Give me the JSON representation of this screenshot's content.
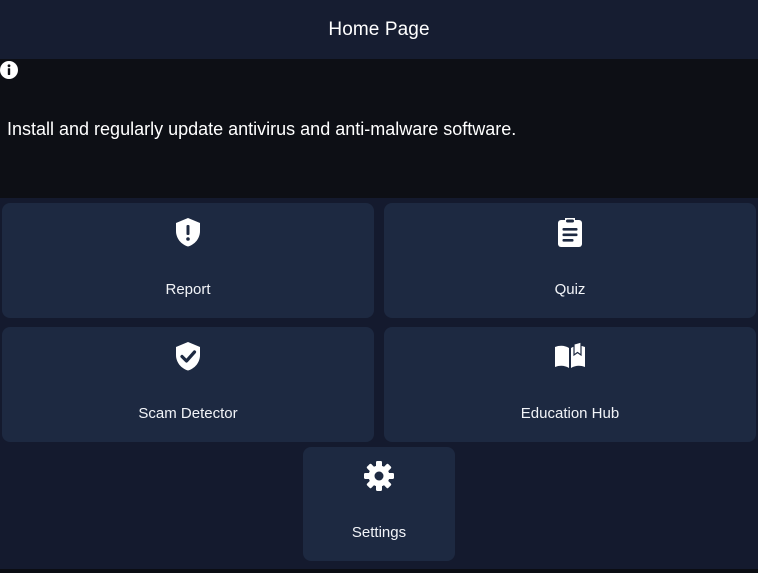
{
  "header": {
    "title": "Home Page"
  },
  "tip": {
    "icon": "info-icon",
    "text": "Install and regularly update antivirus and anti-malware software."
  },
  "tiles": [
    {
      "label": "Report",
      "icon": "shield-alert-icon"
    },
    {
      "label": "Quiz",
      "icon": "clipboard-list-icon"
    },
    {
      "label": "Scam Detector",
      "icon": "shield-check-icon"
    },
    {
      "label": "Education Hub",
      "icon": "open-book-icon"
    },
    {
      "label": "Settings",
      "icon": "gear-icon"
    }
  ],
  "colors": {
    "background": "#141a2e",
    "header": "#161d31",
    "banner": "#0d0f15",
    "tile": "#1d2941",
    "text": "#ffffff"
  }
}
